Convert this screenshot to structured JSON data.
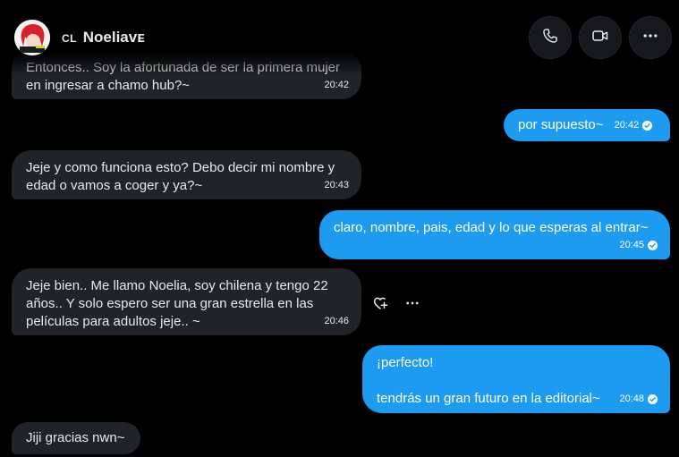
{
  "header": {
    "name_prefix": "CL",
    "name": "Noeliavᴇ",
    "call_icon": "phone-icon",
    "video_icon": "video-camera-icon",
    "more_icon": "more-horizontal-icon"
  },
  "colors": {
    "background": "#000000",
    "incoming_bubble": "#202327",
    "outgoing_bubble": "#1d9bf0",
    "text": "#e7e9ea"
  },
  "messages": [
    {
      "dir": "in",
      "text": "Entonces.. Soy la afortunada de ser la primera mujer\nen ingresar a chamo hub?~",
      "time": "20:42"
    },
    {
      "dir": "out",
      "text": "por supuesto~",
      "time": "20:42",
      "seen": true
    },
    {
      "dir": "in",
      "text": "Jeje y como funciona esto? Debo decir mi nombre y\nedad o vamos a coger y ya?~",
      "time": "20:43"
    },
    {
      "dir": "out",
      "text": "claro, nombre, pais, edad y lo que esperas al entrar~",
      "time": "20:45",
      "seen": true
    },
    {
      "dir": "in",
      "text": "Jeje bien.. Me llamo Noelia, soy chilena y tengo 22\naños.. Y solo espero ser una gran estrella en las\npelículas para adultos jeje.. ~",
      "time": "20:46"
    },
    {
      "dir": "out",
      "text": "¡perfecto!\n\ntendrás un gran futuro en la editorial~",
      "time": "20:48",
      "seen": true
    },
    {
      "dir": "in",
      "text": "Jiji gracias nwn~"
    }
  ],
  "message_actions": {
    "react_icon": "add-reaction-heart-icon",
    "more_icon": "more-horizontal-icon"
  }
}
